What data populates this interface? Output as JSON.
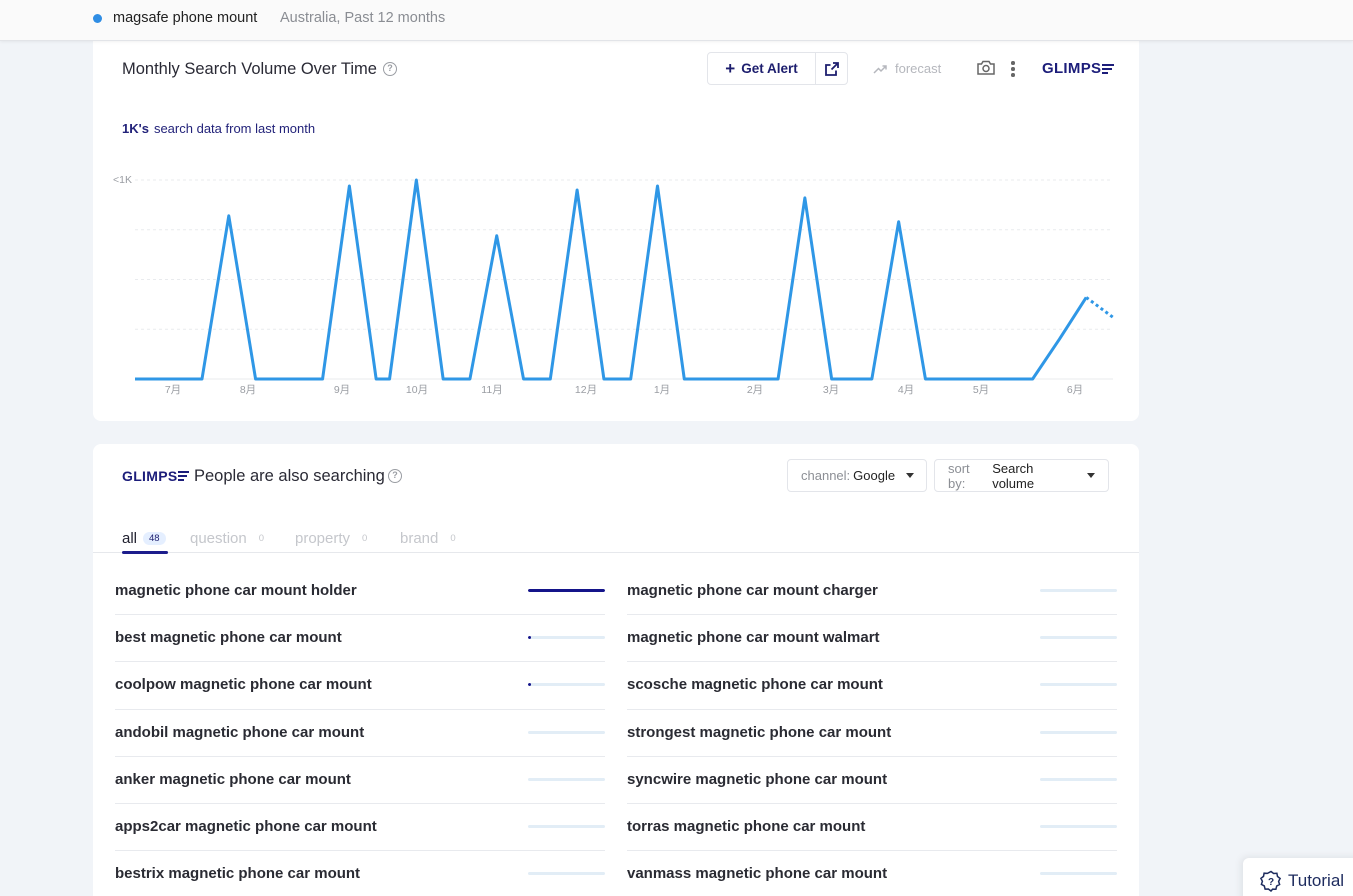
{
  "topbar": {
    "keyword": "magsafe phone mount",
    "subtitle": "Australia, Past 12 months",
    "dot_color": "#2f8de4"
  },
  "trend_card": {
    "title": "Monthly Search Volume Over Time",
    "help_icon": "help-circle-icon",
    "get_alert_label": "Get Alert",
    "external_link_icon": "external-link-icon",
    "forecast_label": "forecast",
    "camera_icon": "camera-icon",
    "more_icon": "kebab-menu-icon",
    "logo_text": "GLIMPS",
    "meta_strong": "1K's",
    "meta_text": "search data from last month"
  },
  "chart_data": {
    "type": "line",
    "ylabel_tick": "<1K",
    "x_tick_labels": [
      "7月",
      "8月",
      "9月",
      "10月",
      "11月",
      "12月",
      "1月",
      "2月",
      "3月",
      "4月",
      "5月",
      "6月"
    ],
    "series": [
      {
        "color": "#2f97e6",
        "points": [
          [
            0.0,
            0
          ],
          [
            1.0,
            0
          ],
          [
            1.4,
            0.82
          ],
          [
            1.8,
            0
          ],
          [
            2.8,
            0
          ],
          [
            3.2,
            0.97
          ],
          [
            3.6,
            0
          ],
          [
            3.8,
            0
          ],
          [
            4.2,
            1.0
          ],
          [
            4.6,
            0
          ],
          [
            5.0,
            0
          ],
          [
            5.4,
            0.72
          ],
          [
            5.8,
            0
          ],
          [
            6.2,
            0
          ],
          [
            6.6,
            0.95
          ],
          [
            7.0,
            0
          ],
          [
            7.4,
            0
          ],
          [
            7.8,
            0.97
          ],
          [
            8.2,
            0
          ],
          [
            9.6,
            0
          ],
          [
            10.0,
            0.91
          ],
          [
            10.4,
            0
          ],
          [
            11.0,
            0
          ],
          [
            11.4,
            0.79
          ],
          [
            11.8,
            0
          ],
          [
            13.4,
            0
          ],
          [
            13.8,
            0.2
          ],
          [
            14.2,
            0.41
          ]
        ],
        "forecast": [
          [
            14.2,
            0.41
          ],
          [
            14.6,
            0.31
          ]
        ]
      }
    ],
    "ylim": [
      0,
      1
    ],
    "grid": true
  },
  "related_card": {
    "logo_text": "GLIMPS",
    "title": "People are also searching",
    "channel_label": "channel:",
    "channel_value": "Google",
    "sort_label": "sort by:",
    "sort_value": "Search volume",
    "tabs": [
      {
        "label": "all",
        "count": "48",
        "active": true
      },
      {
        "label": "question",
        "count": "0",
        "active": false
      },
      {
        "label": "property",
        "count": "0",
        "active": false
      },
      {
        "label": "brand",
        "count": "0",
        "active": false
      }
    ],
    "left_items": [
      {
        "text": "magnetic phone car mount holder",
        "level": 1.0
      },
      {
        "text": "best magnetic phone car mount",
        "level": 0.04
      },
      {
        "text": "coolpow magnetic phone car mount",
        "level": 0.04
      },
      {
        "text": "andobil magnetic phone car mount",
        "level": 0
      },
      {
        "text": "anker magnetic phone car mount",
        "level": 0
      },
      {
        "text": "apps2car magnetic phone car mount",
        "level": 0
      },
      {
        "text": "bestrix magnetic phone car mount",
        "level": 0
      }
    ],
    "right_items": [
      {
        "text": "magnetic phone car mount charger",
        "level": 0
      },
      {
        "text": "magnetic phone car mount walmart",
        "level": 0
      },
      {
        "text": "scosche magnetic phone car mount",
        "level": 0
      },
      {
        "text": "strongest magnetic phone car mount",
        "level": 0
      },
      {
        "text": "syncwire magnetic phone car mount",
        "level": 0
      },
      {
        "text": "torras magnetic phone car mount",
        "level": 0
      },
      {
        "text": "vanmass magnetic phone car mount",
        "level": 0
      }
    ]
  },
  "tutorial": {
    "label": "Tutorial"
  }
}
